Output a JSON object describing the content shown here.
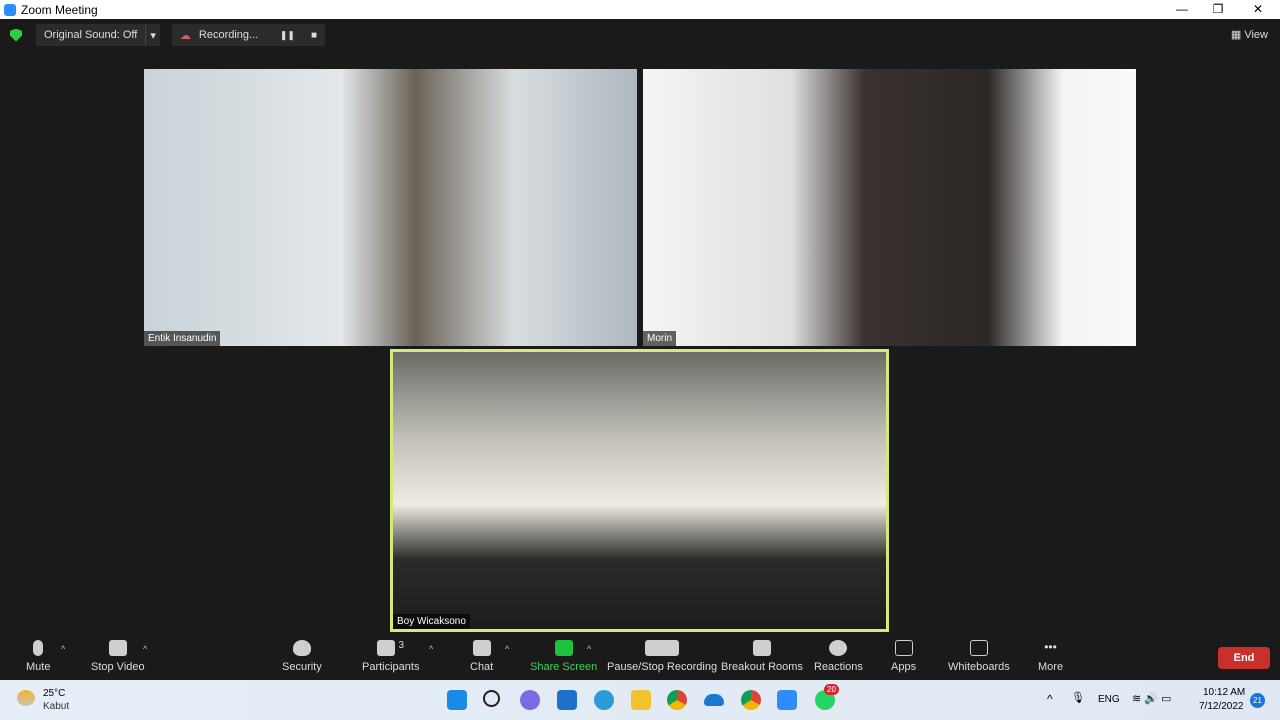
{
  "window": {
    "title": "Zoom Meeting",
    "minimize": "—",
    "restore": "❐",
    "close": "✕"
  },
  "topbar": {
    "original_sound": "Original Sound: Off",
    "recording": "Recording...",
    "pause": "❚❚",
    "stop": "■",
    "view": "View"
  },
  "participants": [
    {
      "name": "Entik Insanudin"
    },
    {
      "name": "Morin"
    },
    {
      "name": "Boy Wicaksono",
      "active_speaker": true
    }
  ],
  "toolbar": {
    "mute": "Mute",
    "stop_video": "Stop Video",
    "security": "Security",
    "participants": "Participants",
    "participants_count": "3",
    "chat": "Chat",
    "share_screen": "Share Screen",
    "pause_stop_recording": "Pause/Stop Recording",
    "breakout_rooms": "Breakout Rooms",
    "reactions": "Reactions",
    "apps": "Apps",
    "whiteboards": "Whiteboards",
    "more": "More",
    "end": "End"
  },
  "taskbar": {
    "temperature": "25°C",
    "weather": "Kabut",
    "language": "ENG",
    "time": "10:12 AM",
    "date": "7/12/2022",
    "notifications": "21",
    "whatsapp_badge": "20"
  },
  "colors": {
    "end": "#c9302c",
    "share": "#1dc33f",
    "speaker_border": "#d7e97a"
  }
}
